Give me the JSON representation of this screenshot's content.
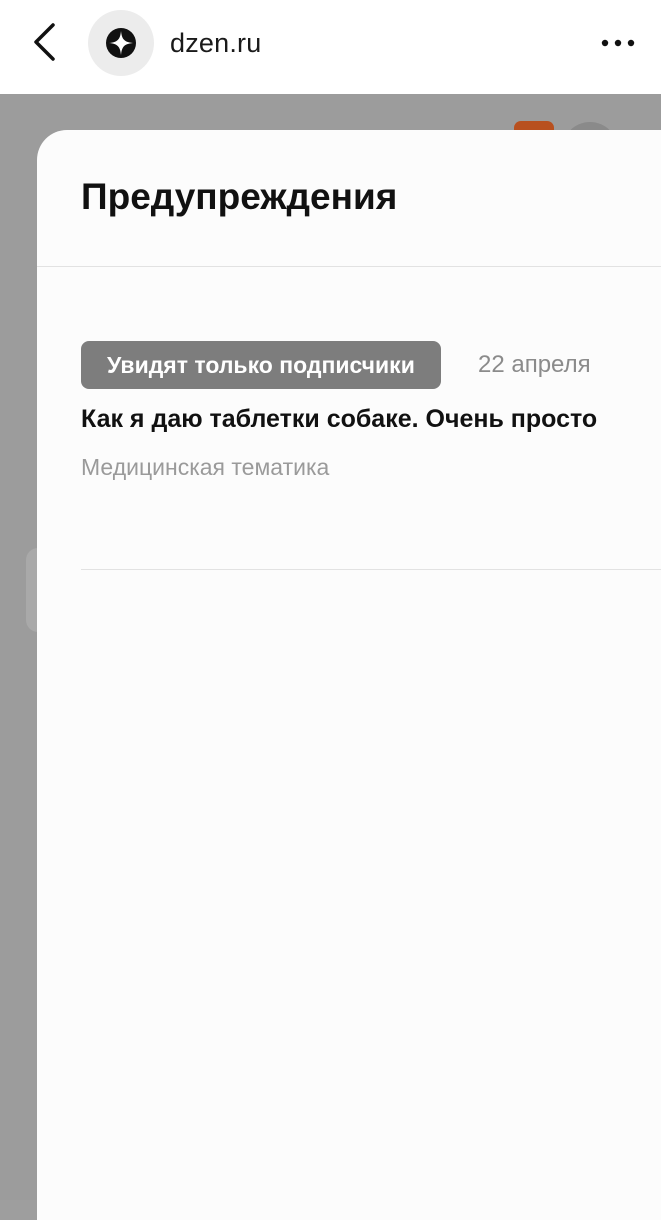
{
  "browser": {
    "back_icon": "chevron-left-icon",
    "site_icon": "zen-star-icon",
    "site_name": "dzen.ru",
    "more_icon": "more-horizontal-icon"
  },
  "sheet": {
    "title": "Предупреждения",
    "warnings": [
      {
        "badge": "Увидят только подписчики",
        "date": "22 апреля",
        "title": "Как я даю таблетки собаке. Очень просто",
        "reason": "Медицинская тематика"
      }
    ]
  },
  "colors": {
    "overlay_gray": "#9e9e9e",
    "badge_gray": "#7d7d7d",
    "notification_badge": "#b8501f"
  }
}
